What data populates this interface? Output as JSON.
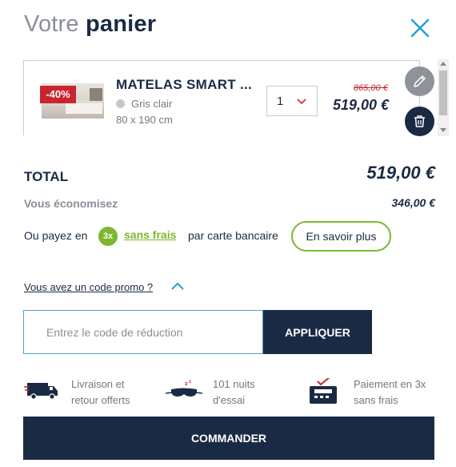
{
  "header": {
    "title_light": "Votre",
    "title_bold": "panier"
  },
  "cart": {
    "items": [
      {
        "discount_badge": "-40%",
        "name": "MATELAS SMART ...",
        "color": "Gris clair",
        "size": "80 x 190 cm",
        "quantity": "1",
        "old_price": "865,00 €",
        "price": "519,00 €"
      }
    ]
  },
  "summary": {
    "total_label": "TOTAL",
    "total_value": "519,00 €",
    "savings_label": "Vous économisez",
    "savings_value": "346,00 €"
  },
  "payment": {
    "prefix": "Ou payez en",
    "badge": "3x",
    "free_label": "sans frais",
    "suffix": "par carte bancaire",
    "more_button": "En savoir plus"
  },
  "promo": {
    "link": "Vous avez un code promo ?",
    "placeholder": "Entrez le code de réduction",
    "apply_button": "APPLIQUER"
  },
  "features": [
    {
      "icon": "delivery-truck-icon",
      "line1": "Livraison et",
      "line2": "retour offerts"
    },
    {
      "icon": "sleep-mask-icon",
      "line1": "101 nuits",
      "line2": "d'essai"
    },
    {
      "icon": "card-terminal-icon",
      "line1": "Paiement en 3x",
      "line2": "sans frais"
    }
  ],
  "order_button": "COMMANDER",
  "colors": {
    "navy": "#1b2a44",
    "green": "#7cb82f",
    "discount_red": "#c8262f",
    "close_blue": "#2a9fd6"
  }
}
